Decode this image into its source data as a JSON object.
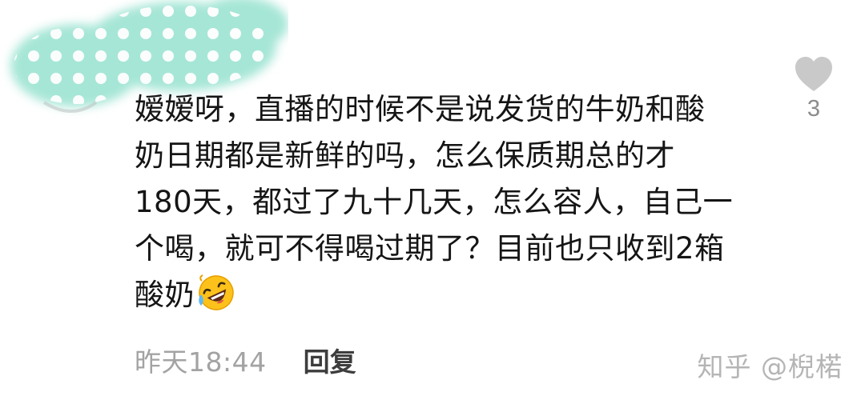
{
  "comment": {
    "lines": [
      "嫒嫒呀，直播的时候不是说发货的牛奶和酸",
      "奶日期都是新鲜的吗，怎么保质期总的才",
      "180天，都过了九十几天，怎么容人，自己一",
      "个喝，就可不得喝过期了？目前也只收到2箱",
      "酸奶"
    ],
    "emoji_icon": "rolling-on-floor-laughing-emoji"
  },
  "meta": {
    "time": "昨天18:44",
    "reply_label": "回复"
  },
  "like": {
    "icon": "heart-icon",
    "count": "3"
  },
  "watermark": "知乎 @棿楉",
  "colors": {
    "avatar_mint": "#9fe4d3",
    "text": "#151515",
    "muted": "#a3a3a3",
    "heart": "#c9c9c9"
  }
}
